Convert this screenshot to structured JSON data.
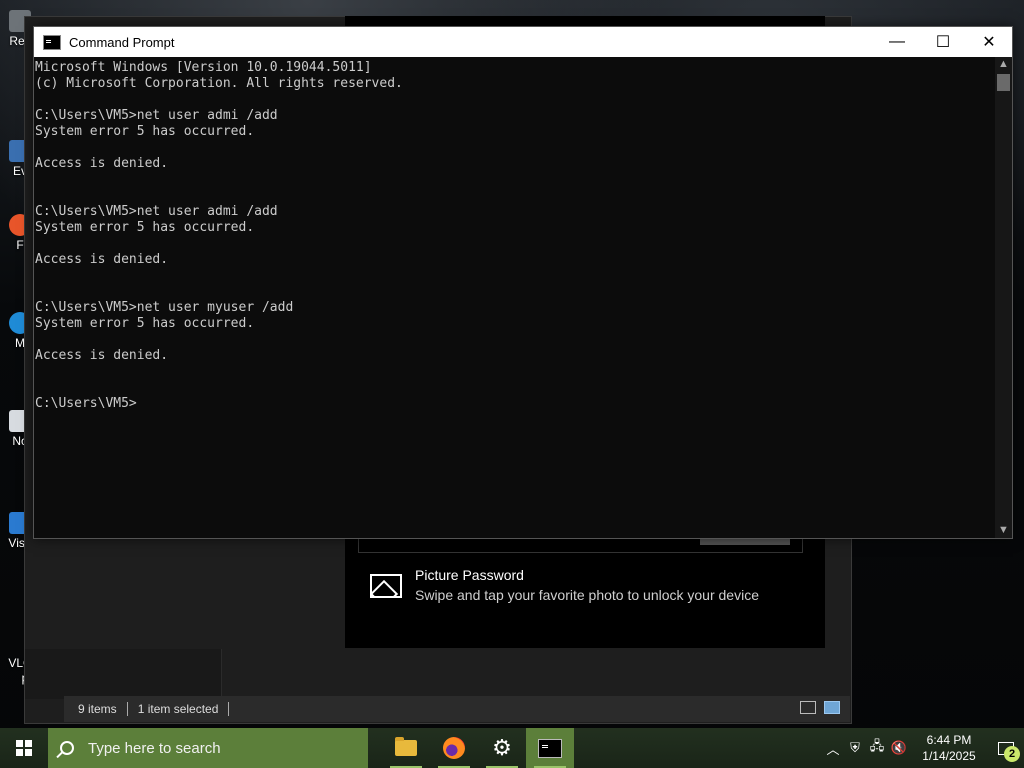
{
  "desktop": {
    "icons": [
      {
        "label": "Rec"
      },
      {
        "label": "Ev"
      },
      {
        "label": "F"
      },
      {
        "label": "M"
      },
      {
        "label": "No"
      },
      {
        "label": "Visu"
      },
      {
        "label": "VLC media player"
      }
    ]
  },
  "explorer": {
    "status": {
      "item_count": "9 items",
      "selection": "1 item selected"
    }
  },
  "settings": {
    "picture_password": {
      "title": "Picture Password",
      "description": "Swipe and tap your favorite photo to unlock your device"
    }
  },
  "cmd": {
    "title": "Command Prompt",
    "controls": {
      "minimize": "—",
      "maximize": "☐",
      "close": "✕"
    },
    "lines": [
      "Microsoft Windows [Version 10.0.19044.5011]",
      "(c) Microsoft Corporation. All rights reserved.",
      "",
      "C:\\Users\\VM5>net user admi /add",
      "System error 5 has occurred.",
      "",
      "Access is denied.",
      "",
      "",
      "C:\\Users\\VM5>net user admi /add",
      "System error 5 has occurred.",
      "",
      "Access is denied.",
      "",
      "",
      "C:\\Users\\VM5>net user myuser /add",
      "System error 5 has occurred.",
      "",
      "Access is denied.",
      "",
      "",
      "C:\\Users\\VM5>"
    ]
  },
  "taskbar": {
    "search_placeholder": "Type here to search",
    "apps": [
      "file-explorer",
      "firefox",
      "settings",
      "command-prompt"
    ],
    "clock": {
      "time": "6:44 PM",
      "date": "1/14/2025"
    },
    "notification_count": "2"
  },
  "colors": {
    "taskbar_accent": "#5c7f3a",
    "console_text": "#cccccc",
    "console_bg": "#0c0c0c"
  }
}
